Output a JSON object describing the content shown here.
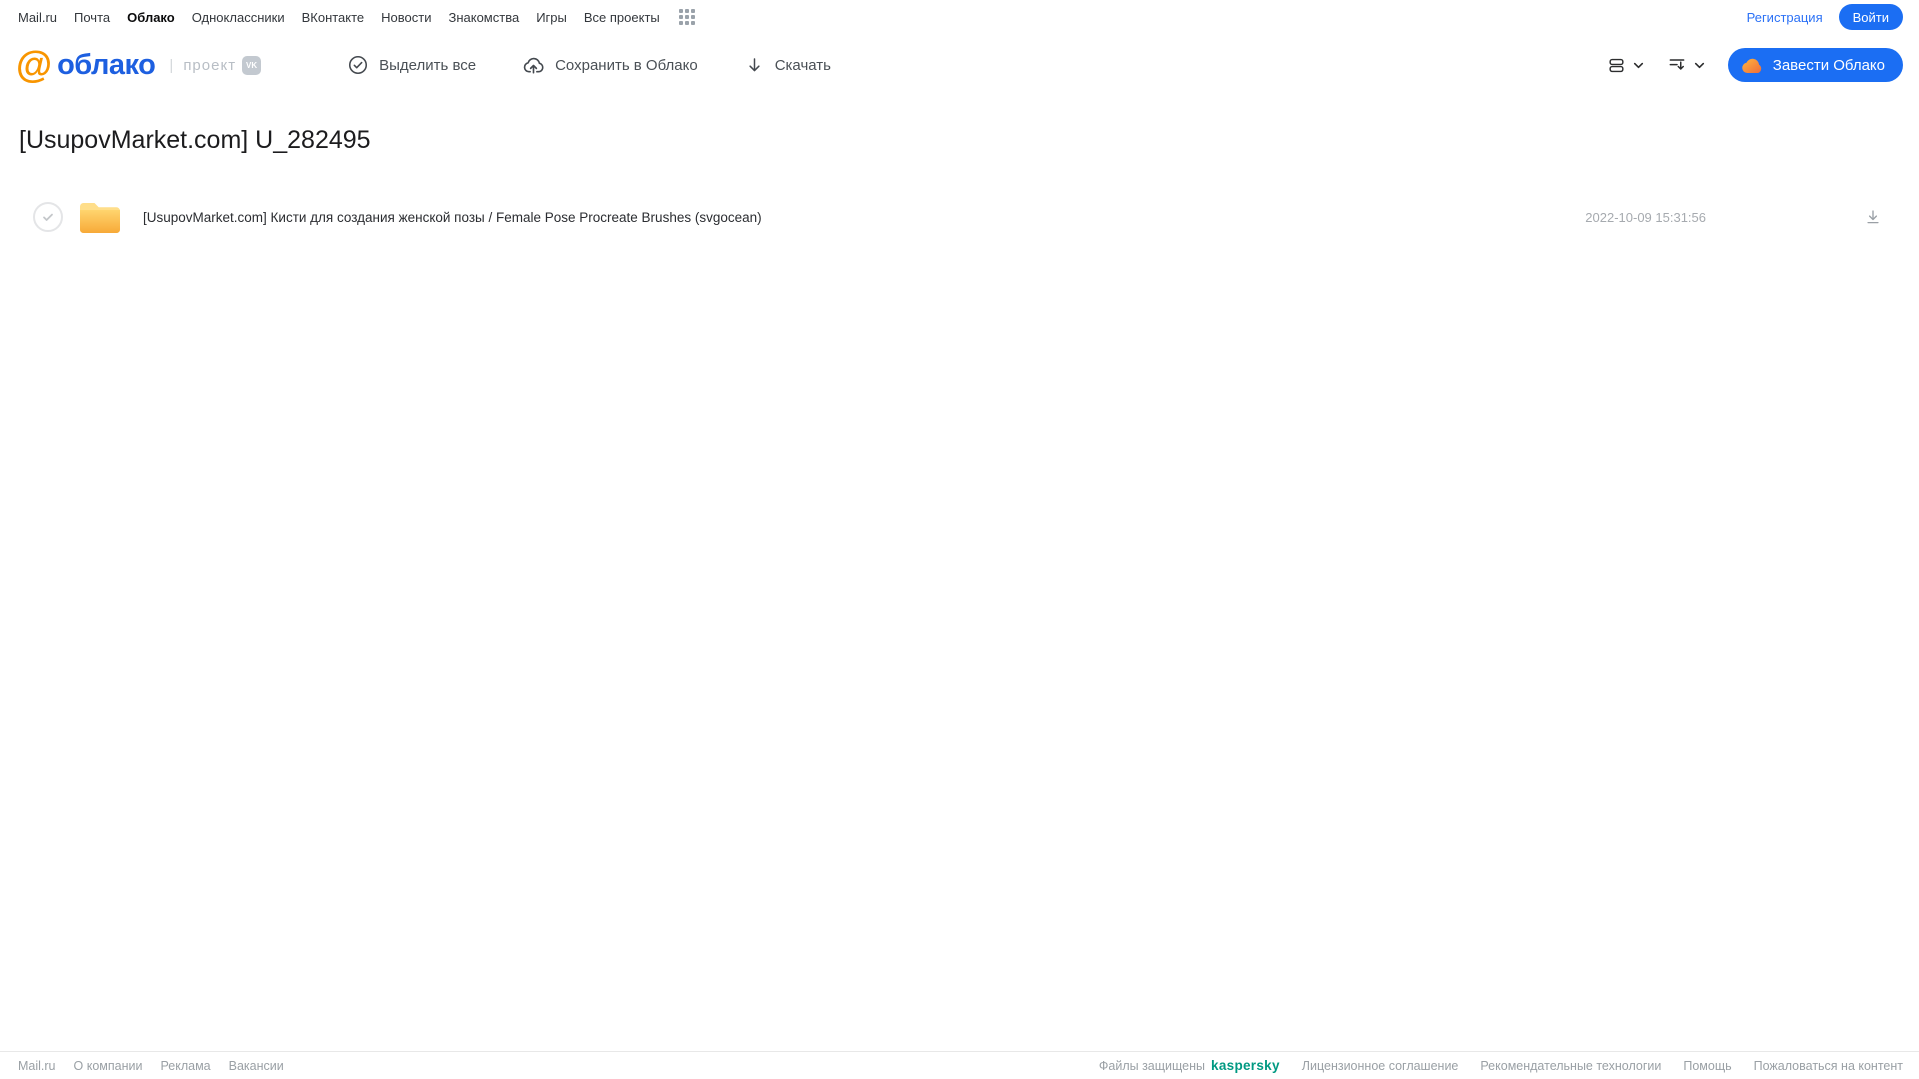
{
  "topbar": {
    "links": [
      "Mail.ru",
      "Почта",
      "Облако",
      "Одноклассники",
      "ВКонтакте",
      "Новости",
      "Знакомства",
      "Игры",
      "Все проекты"
    ],
    "registration": "Регистрация",
    "login": "Войти"
  },
  "header": {
    "logo_at": "@",
    "logo_text": "облако",
    "divider": "|",
    "project": "проект",
    "vk_badge": "VK",
    "select_all": "Выделить все",
    "save_to_cloud": "Сохранить в Облако",
    "download": "Скачать",
    "create_cloud": "Завести Облако"
  },
  "page": {
    "title": "[UsupovMarket.com] U_282495"
  },
  "file_list": [
    {
      "icon": "folder-icon",
      "name": "[UsupovMarket.com] Кисти для создания женской позы / Female Pose Procreate Brushes (svgocean)",
      "modified": "2022-10-09 15:31:56"
    }
  ],
  "footer": {
    "links_left": [
      "Mail.ru",
      "О компании",
      "Реклама",
      "Вакансии"
    ],
    "protected_by": "Файлы защищены",
    "kaspersky": "kaspersky",
    "links_right": [
      "Лицензионное соглашение",
      "Рекомендательные технологии",
      "Помощь",
      "Пожаловаться на контент"
    ]
  },
  "colors": {
    "primary_blue": "#1b6ef3",
    "link_blue": "#2b71f6",
    "logo_blue": "#1d5fe0",
    "logo_orange": "#f89500",
    "folder_top": "#ffd56e",
    "folder_bottom": "#f7a938",
    "kaspersky_green": "#009982"
  }
}
